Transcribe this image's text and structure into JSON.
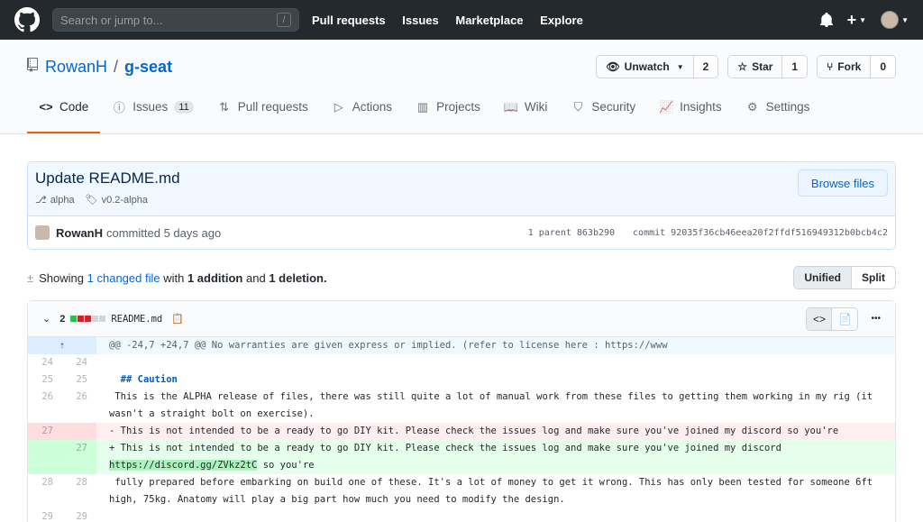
{
  "header": {
    "search_placeholder": "Search or jump to...",
    "search_key": "/",
    "nav": [
      "Pull requests",
      "Issues",
      "Marketplace",
      "Explore"
    ],
    "plus": "+"
  },
  "repo": {
    "owner": "RowanH",
    "sep": "/",
    "name": "g-seat",
    "watch_label": "Unwatch",
    "watch_count": "2",
    "star_label": "Star",
    "star_count": "1",
    "fork_label": "Fork",
    "fork_count": "0"
  },
  "tabs": [
    {
      "label": "Code",
      "icon": "code-icon"
    },
    {
      "label": "Issues",
      "icon": "issue-icon",
      "badge": "11"
    },
    {
      "label": "Pull requests",
      "icon": "pull-request-icon"
    },
    {
      "label": "Actions",
      "icon": "play-icon"
    },
    {
      "label": "Projects",
      "icon": "project-icon"
    },
    {
      "label": "Wiki",
      "icon": "book-icon"
    },
    {
      "label": "Security",
      "icon": "shield-icon"
    },
    {
      "label": "Insights",
      "icon": "graph-icon"
    },
    {
      "label": "Settings",
      "icon": "gear-icon"
    }
  ],
  "commit": {
    "title": "Update README.md",
    "branch": "alpha",
    "tag": "v0.2-alpha",
    "browse_label": "Browse files",
    "author": "RowanH",
    "time_text": "committed 5 days ago",
    "parent_text": "1 parent 863b290",
    "commit_text": "commit 92035f36cb46eea20f2ffdf516949312b0bcb4c2"
  },
  "summary": {
    "prefix": "Showing",
    "files_link": "1 changed file",
    "with": "with",
    "additions": "1 addition",
    "and": "and",
    "deletions": "1 deletion.",
    "unified_label": "Unified",
    "split_label": "Split"
  },
  "file": {
    "count": "2",
    "name": "README.md",
    "more": "•••",
    "hunk": "@@ -24,7 +24,7 @@ No warranties are given express or implied. (refer to license here : https://www",
    "lines": [
      {
        "type": "ctx",
        "old": "24",
        "new": "24",
        "text": ""
      },
      {
        "type": "ctx",
        "old": "25",
        "new": "25",
        "text": "  ## Caution",
        "heading": true
      },
      {
        "type": "ctx",
        "old": "26",
        "new": "26",
        "text": " This is the ALPHA release of files, there was still quite a lot of manual work from these files to getting them working in my rig (it wasn't a straight bolt on exercise)."
      },
      {
        "type": "del",
        "old": "27",
        "new": "",
        "text": "- This is not intended to be a ready to go DIY kit. Please check the issues log and make sure you've joined my discord so you're"
      },
      {
        "type": "add",
        "old": "",
        "new": "27",
        "text": "+ This is not intended to be a ready to go DIY kit. Please check the issues log and make sure you've joined my discord ",
        "url": "https://discord.gg/ZVkz2tC",
        "after": " so you're"
      },
      {
        "type": "ctx",
        "old": "28",
        "new": "28",
        "text": " fully prepared before embarking on build one of these. It's a lot of money to get it wrong. This has only been tested for someone 6ft high, 75kg. Anatomy will play a big part how much you need to modify the design."
      },
      {
        "type": "ctx",
        "old": "29",
        "new": "29",
        "text": ""
      }
    ]
  },
  "colors": {
    "header_bg": "#24292e",
    "link": "#0366d6",
    "active_tab": "#e36209",
    "del_bg": "#ffeef0",
    "add_bg": "#e6ffed"
  }
}
